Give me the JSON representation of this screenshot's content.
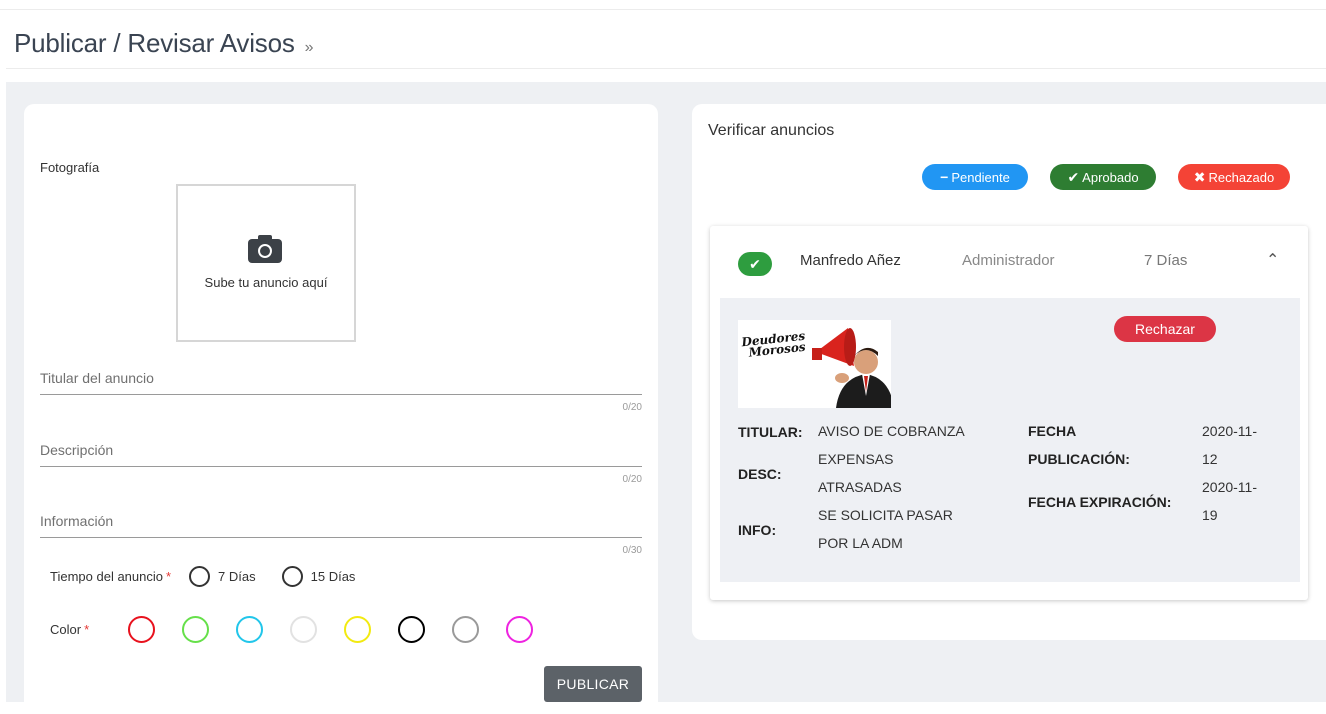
{
  "header": {
    "title": "Publicar / Revisar Avisos",
    "chevron": "»"
  },
  "form": {
    "photo_label": "Fotografía",
    "upload_text": "Sube tu anuncio aquí",
    "fields": [
      {
        "placeholder": "Titular del anuncio",
        "value": "",
        "counter": "0/20"
      },
      {
        "placeholder": "Descripción",
        "value": "",
        "counter": "0/20"
      },
      {
        "placeholder": "Información",
        "value": "",
        "counter": "0/30"
      }
    ],
    "duration_label": "Tiempo del anuncio",
    "duration_options": [
      "7 Días",
      "15 Días"
    ],
    "color_label": "Color",
    "required_mark": "*",
    "colors": [
      "#e8121e",
      "#66e04a",
      "#22c6ea",
      "#e2e2e2",
      "#f2ea11",
      "#000000",
      "#9a9a9a",
      "#ee23e0"
    ],
    "publish_button": "PUBLICAR"
  },
  "verify": {
    "title": "Verificar anuncios",
    "filters": [
      {
        "icon": "minus-icon",
        "label": "Pendiente",
        "color": "#2196f3"
      },
      {
        "icon": "check-icon",
        "label": "Aprobado",
        "color": "#2e7d32"
      },
      {
        "icon": "x-icon",
        "label": "Rechazado",
        "color": "#f44336"
      }
    ],
    "item": {
      "status_color": "#2e9d3f",
      "name": "Manfredo Añez",
      "role": "Administrador",
      "days": "7 Días",
      "image_text": [
        "Deudores",
        "Morosos"
      ],
      "reject_button": "Rechazar",
      "titular_label": "TITULAR:",
      "titular_value": "AVISO DE COBRANZA",
      "desc_label": "DESC:",
      "desc_value": [
        "EXPENSAS",
        "ATRASADAS"
      ],
      "info_label": "INFO:",
      "info_value": [
        "SE SOLICITA PASAR",
        "POR LA ADM"
      ],
      "fecha_pub_label": [
        "FECHA",
        "PUBLICACIÓN:"
      ],
      "fecha_pub_value": [
        "2020-11-",
        "12"
      ],
      "fecha_exp_label": "FECHA EXPIRACIÓN:",
      "fecha_exp_value": [
        "2020-11-",
        "19"
      ]
    }
  }
}
